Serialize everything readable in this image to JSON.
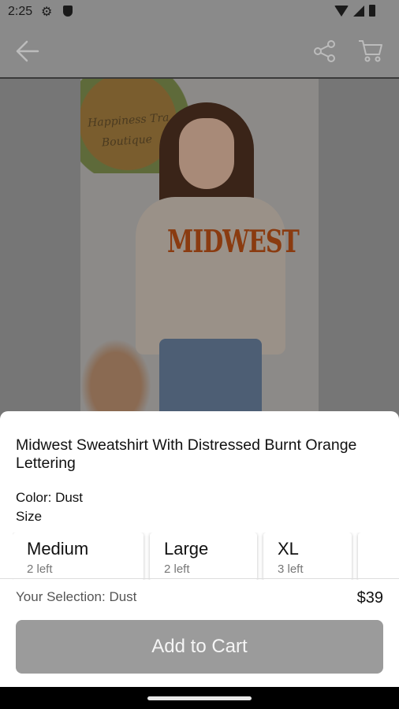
{
  "status_bar": {
    "time": "2:25"
  },
  "product": {
    "title": "Midwest Sweatshirt With Distressed Burnt Orange Lettering",
    "color_label": "Color: Dust",
    "size_label": "Size",
    "sizes": [
      {
        "name": "Medium",
        "stock": "2 left"
      },
      {
        "name": "Large",
        "stock": "2 left"
      },
      {
        "name": "XL",
        "stock": "3 left"
      }
    ],
    "selection": "Your Selection: Dust",
    "price": "$39",
    "add_to_cart_label": "Add to Cart"
  },
  "photo": {
    "shirt_text": "MIDWEST",
    "sign_text_line1": "Happiness Tra",
    "sign_text_line2": "Boutique"
  },
  "icons": {
    "back": "arrow-left-icon",
    "share": "share-icon",
    "cart": "cart-icon"
  },
  "colors": {
    "sheet_bg": "#ffffff",
    "button_bg": "#9b9b9b",
    "overlay": "#7f7f7f"
  }
}
